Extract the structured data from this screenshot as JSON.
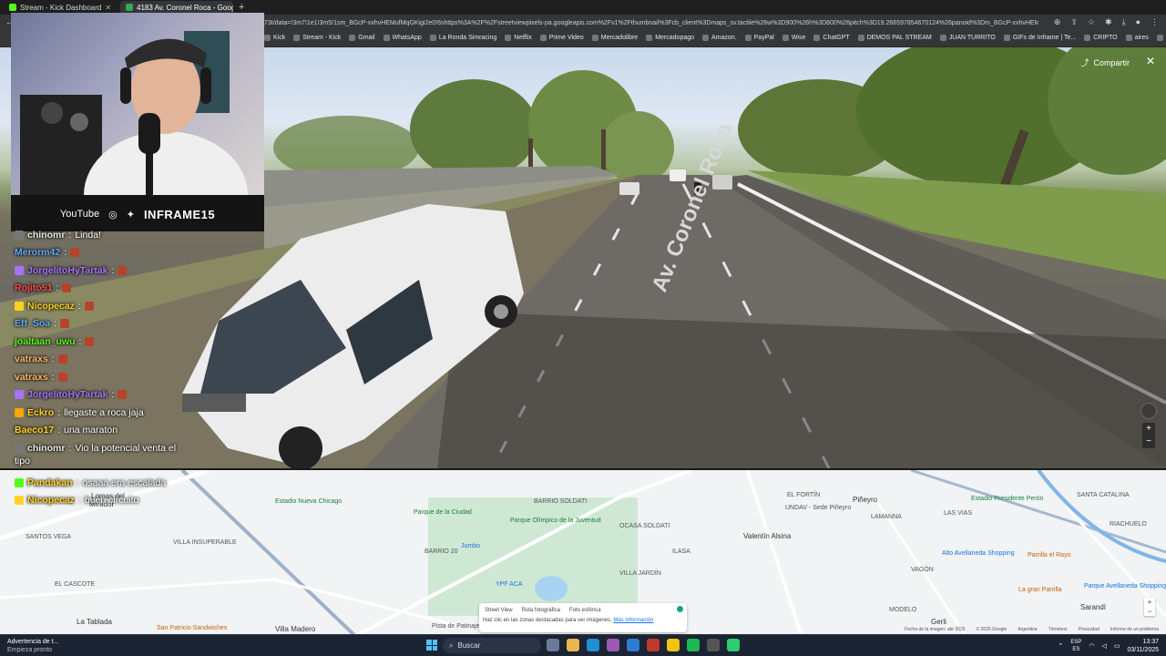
{
  "browser": {
    "tabs": [
      {
        "label": "Stream - Kick Dashboard",
        "color": "#53fc18",
        "active": false
      },
      {
        "label": "4183 Av. Coronel Roca - Google",
        "color": "#34a853",
        "active": true
      }
    ],
    "url": "73t/data=!3m7!1e1!3m5!1sm_BGcP-xxhvHEMufMqGKigi2e0!6shttps%3A%2F%2Fstreetviewpixels-pa.googleapis.com%2Fv1%2Fthumbnail%3Fcb_client%3Dmaps_sv.tactile%26w%3D900%26h%3D600%26pitch%3D19.266597854670124%26panoid%3Dm_BGcP-xxhvHEMufMqGKigi%...",
    "bookmarks": [
      "Kick",
      "Stream - Kick",
      "Gmail",
      "WhatsApp",
      "La Ronda Simracing",
      "Netflix",
      "Prime Video",
      "Mercadolibre",
      "Mercadopago",
      "Amazon.",
      "PayPal",
      "Wise",
      "ChatGPT",
      "DEMOS PAL STREAM",
      "JUAN TURRITO",
      "GIFs de Inframe | Te...",
      "CRIPTO",
      "aires",
      "EL MEGA PACK PAP..."
    ]
  },
  "streetview": {
    "share_label": "Compartir",
    "road_label": "Av. Coronel Roca"
  },
  "webcam": {
    "platform": "YouTube",
    "brand": "INFRAME15"
  },
  "chat": [
    {
      "user": "chinomr",
      "message": "Linda!",
      "color": "#e8e8e8",
      "badge": "#777777"
    },
    {
      "user": "Merorm42",
      "message": "",
      "color": "#5fa8ff",
      "badge": ""
    },
    {
      "user": "JorgelitoHyTartak",
      "message": "",
      "color": "#a970ff",
      "badge": "#a970ff"
    },
    {
      "user": "Rojito51",
      "message": "",
      "color": "#ff4a4a",
      "badge": ""
    },
    {
      "user": "Nicopecaz",
      "message": "",
      "color": "#ffd21f",
      "badge": "#ffd21f"
    },
    {
      "user": "Eff_Soa",
      "message": "",
      "color": "#5fa8ff",
      "badge": ""
    },
    {
      "user": "joaltaan_uwu",
      "message": "",
      "color": "#53fc18",
      "badge": ""
    },
    {
      "user": "vatraxs",
      "message": "",
      "color": "#ffb36b",
      "badge": ""
    },
    {
      "user": "vatraxs",
      "message": "",
      "color": "#ffb36b",
      "badge": ""
    },
    {
      "user": "JorgelitoHyTartak",
      "message": "",
      "color": "#a970ff",
      "badge": "#a970ff"
    },
    {
      "user": "Eckro",
      "message": "llegaste a roca jaja",
      "color": "#ffd21f",
      "badge": "#ffa500"
    },
    {
      "user": "Baeco17",
      "message": "una maraton",
      "color": "#ffd21f",
      "badge": ""
    },
    {
      "user": "chinomr",
      "message": "Vio la potencial venta el",
      "color": "#e8e8e8",
      "badge": "#777777"
    }
  ],
  "chat_wrap": "tipo",
  "chat_bottom": [
    {
      "user": "Pandakan",
      "message": "osaaa era escalada",
      "color": "#ffd21f",
      "badge": "#53fc18"
    },
    {
      "user": "Nicopecaz",
      "message": "buen circuito",
      "color": "#ffd21f",
      "badge": "#ffd21f"
    }
  ],
  "map": {
    "labels": [
      "Lomas del",
      "Mirador",
      "Villa Madero",
      "La Tablada",
      "SANTOS VEGA",
      "VILLA INSUPERABLE",
      "EL CASCOTE",
      "Estadio Nueva Chicago",
      "Parque de la Ciudad",
      "BARRIO SOLDATI",
      "Parque Olímpico de la Juventud",
      "OCASA SOLDATI",
      "BARRIO 20",
      "VILLA JARDÍN",
      "ILASA",
      "Jumbo",
      "YPF ACA",
      "Pista de Patinaje",
      "EL FORTÍN",
      "UNDAV - Sede Piñeyro",
      "Piñeyro",
      "Valentín Alsina",
      "LAMANNA",
      "LAS VIAS",
      "Alto Avellaneda Shopping",
      "Estadio Presidente Perón",
      "SANTA CATALINA",
      "Parrilla el Rayo",
      "La gran Parrilla",
      "Parque Avellaneda Shopping",
      "MODELO",
      "Gerli",
      "Sarandí",
      "San Patricio Sandwiches",
      "VAGÓN",
      "RIACHUELO"
    ],
    "layers": [
      "Street View",
      "Ruta fotográfica",
      "Foto esférica"
    ],
    "hint": "Haz clic en las zonas destacadas para ver imágenes.",
    "hint_link": "Más información",
    "footer": [
      "Fecha de la imagen: abr 2025",
      "© 2025 Google",
      "Argentina",
      "Términos",
      "Privacidad",
      "Informe de un problema"
    ]
  },
  "taskbar": {
    "notification_title": "Advertencia de t...",
    "notification_sub": "Empieza pronto",
    "search_label": "Buscar",
    "lang": "ESP",
    "lang_sub": "ES",
    "time": "13:37",
    "date": "03/11/2025"
  }
}
